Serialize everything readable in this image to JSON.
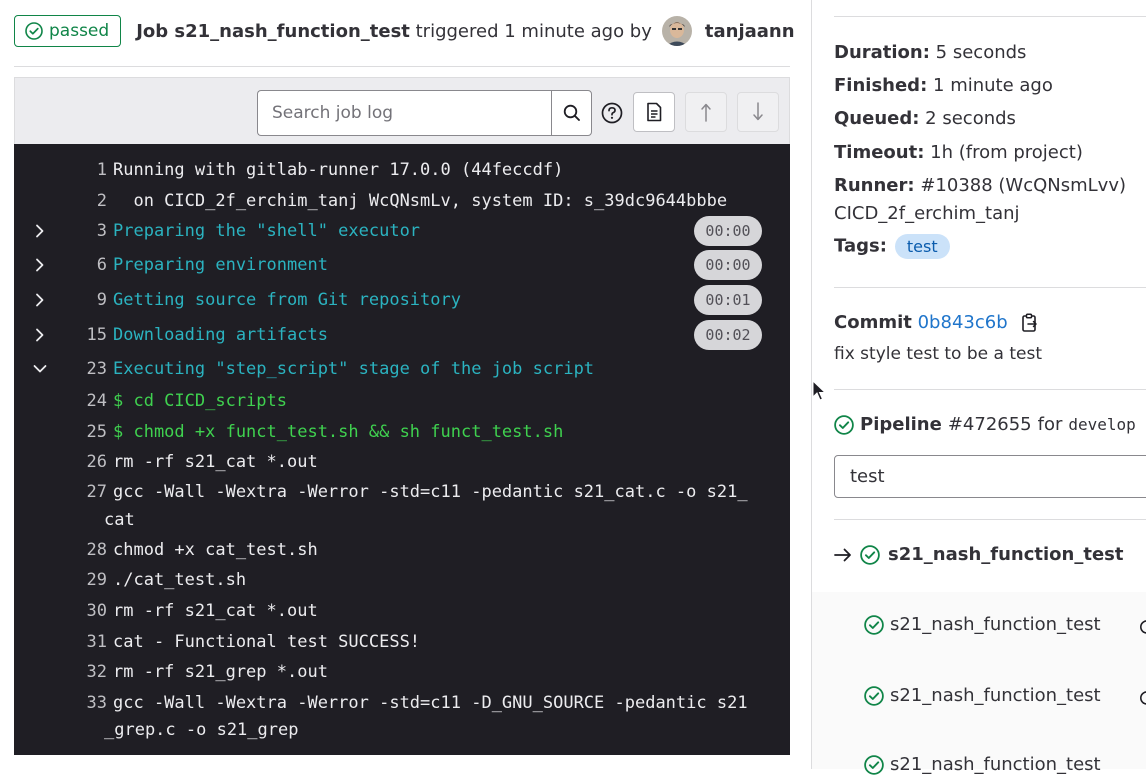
{
  "header": {
    "status": "passed",
    "job_prefix": "Job",
    "job_name": "s21_nash_function_test",
    "triggered_text": "triggered 1 minute ago by",
    "username": "tanjaann"
  },
  "toolbar": {
    "search_placeholder": "Search job log",
    "icons": [
      "search-icon",
      "help-icon",
      "raw-log-icon",
      "scroll-top-icon",
      "scroll-bottom-icon"
    ]
  },
  "log": [
    {
      "num": "1",
      "text": "Running with gitlab-runner 17.0.0 (44feccdf)",
      "kind": "plain"
    },
    {
      "num": "2",
      "text": "  on CICD_2f_erchim_tanj WcQNsmLv, system ID: s_39dc9644bbbe",
      "kind": "plain"
    },
    {
      "num": "3",
      "text": "Preparing the \"shell\" executor",
      "kind": "section",
      "duration": "00:00",
      "collapsed": true
    },
    {
      "num": "6",
      "text": "Preparing environment",
      "kind": "section",
      "duration": "00:00",
      "collapsed": true
    },
    {
      "num": "9",
      "text": "Getting source from Git repository",
      "kind": "section",
      "duration": "00:01",
      "collapsed": true
    },
    {
      "num": "15",
      "text": "Downloading artifacts",
      "kind": "section",
      "duration": "00:02",
      "collapsed": true
    },
    {
      "num": "23",
      "text": "Executing \"step_script\" stage of the job script",
      "kind": "section",
      "collapsed": false
    },
    {
      "num": "24",
      "text": "$ cd CICD_scripts",
      "kind": "cmd"
    },
    {
      "num": "25",
      "text": "$ chmod +x funct_test.sh && sh funct_test.sh",
      "kind": "cmd"
    },
    {
      "num": "26",
      "text": "rm -rf s21_cat *.out",
      "kind": "plain"
    },
    {
      "num": "27",
      "text": "gcc -Wall -Wextra -Werror -std=c11 -pedantic s21_cat.c -o s21_",
      "cont": "cat",
      "kind": "plain"
    },
    {
      "num": "28",
      "text": "chmod +x cat_test.sh",
      "kind": "plain"
    },
    {
      "num": "29",
      "text": "./cat_test.sh",
      "kind": "plain"
    },
    {
      "num": "30",
      "text": "rm -rf s21_cat *.out",
      "kind": "plain"
    },
    {
      "num": "31",
      "text": "cat - Functional test SUCCESS!",
      "kind": "plain"
    },
    {
      "num": "32",
      "text": "rm -rf s21_grep *.out",
      "kind": "plain"
    },
    {
      "num": "33",
      "text": "gcc -Wall -Wextra -Werror -std=c11 -D_GNU_SOURCE -pedantic s21",
      "cont": "_grep.c -o s21_grep",
      "kind": "plain"
    }
  ],
  "sidebar": {
    "duration_label": "Duration:",
    "duration_value": "5 seconds",
    "finished_label": "Finished:",
    "finished_value": "1 minute ago",
    "queued_label": "Queued:",
    "queued_value": "2 seconds",
    "timeout_label": "Timeout:",
    "timeout_value": "1h (from project)",
    "runner_label": "Runner:",
    "runner_value": "#10388 (WcQNsmLvv)",
    "runner_name": "CICD_2f_erchim_tanj",
    "tags_label": "Tags:",
    "tag": "test",
    "commit_label": "Commit",
    "commit_sha": "0b843c6b",
    "commit_message": "fix style test to be a test",
    "pipeline_label": "Pipeline",
    "pipeline_id": "#472655",
    "pipeline_for": "for",
    "pipeline_ref": "develop",
    "stage_select": "test",
    "current_job": "s21_nash_function_test",
    "jobs": [
      "s21_nash_function_test",
      "s21_nash_function_test",
      "s21_nash_function_test"
    ]
  },
  "colors": {
    "success": "#108548",
    "log_bg": "#1f1e24",
    "section": "#2bb3c0",
    "command": "#3fd14f",
    "link": "#1f75cb"
  }
}
